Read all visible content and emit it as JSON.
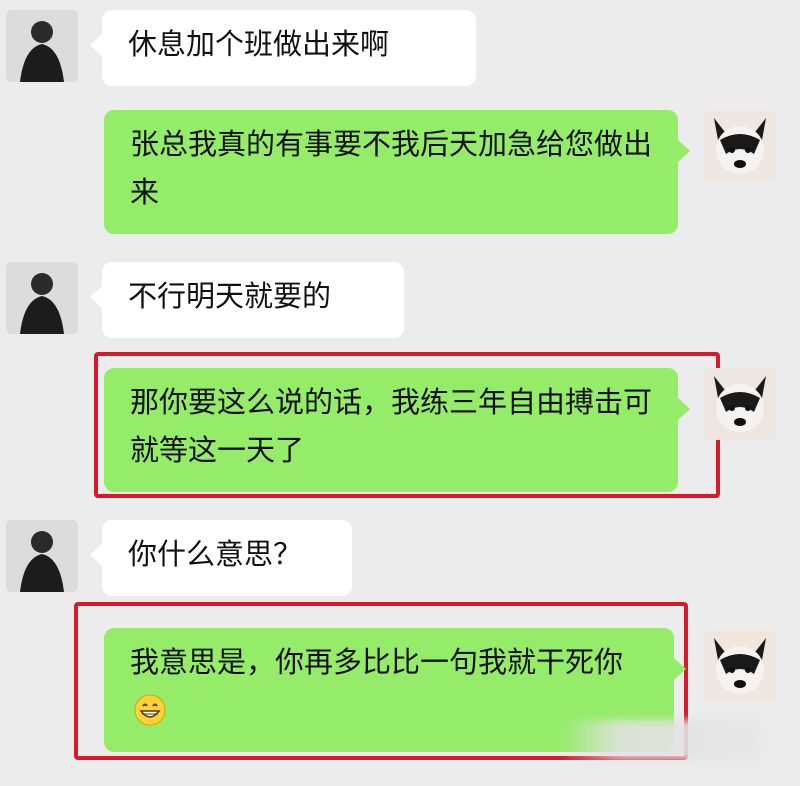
{
  "messages": [
    {
      "side": "incoming",
      "text": "休息加个班做出来啊"
    },
    {
      "side": "outgoing",
      "text": "张总我真的有事要不我后天加急给您做出来"
    },
    {
      "side": "incoming",
      "text": "不行明天就要的"
    },
    {
      "side": "outgoing",
      "text": "那你要这么说的话，我练三年自由搏击可就等这一天了",
      "highlighted": true
    },
    {
      "side": "incoming",
      "text": "你什么意思？"
    },
    {
      "side": "outgoing",
      "text": "我意思是，你再多比比一句我就干死你",
      "highlighted": true,
      "emoji": "grinning-face-emoji"
    }
  ],
  "colors": {
    "background": "#ececec",
    "incoming_bubble": "#ffffff",
    "outgoing_bubble": "#95ec69",
    "highlight_border": "#d61a2a"
  }
}
